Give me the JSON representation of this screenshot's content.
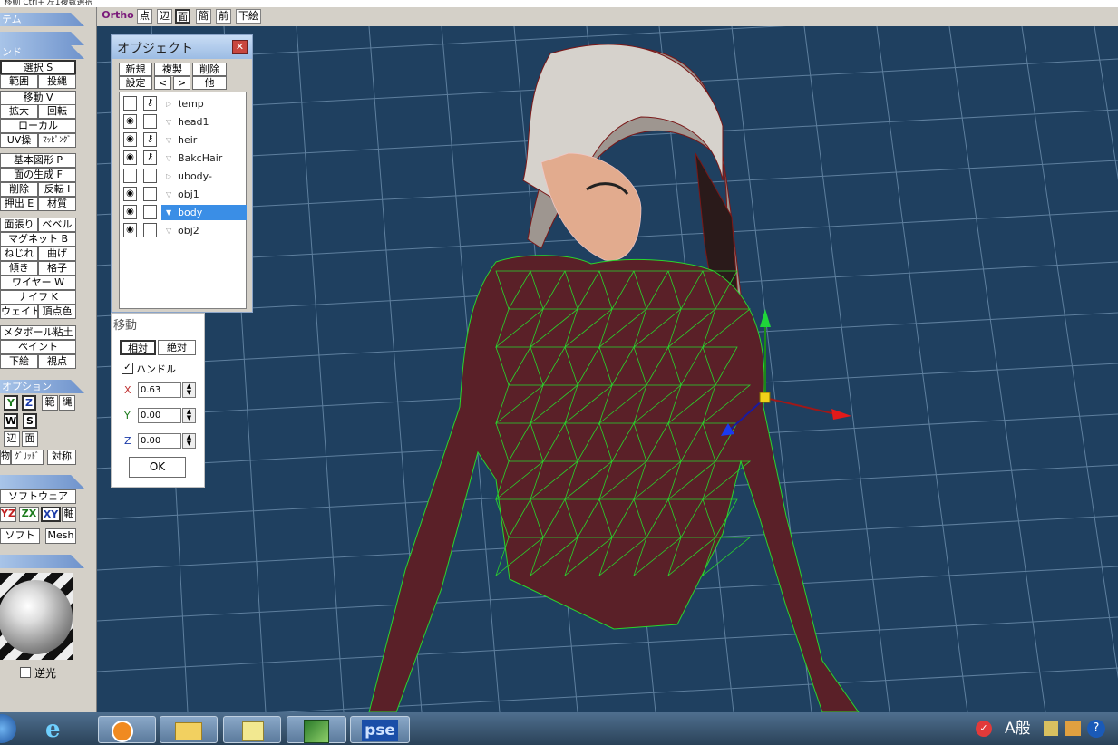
{
  "title_bar": {
    "text": "ﾞ移動  Ctrl+ 左1複数選択"
  },
  "left_panel": {
    "sections": {
      "system": "テム",
      "command_top": "",
      "command": "ンド",
      "option": "オプション",
      "soft": "",
      "material": ""
    },
    "buttons": {
      "select": "選択 S",
      "range": "範囲",
      "rope": "投縄",
      "move": "移動 V",
      "scale": "拡大",
      "rotate": "回転",
      "local": "ローカル",
      "uv": "UV操",
      "mapping": "ﾏｯﾋﾟﾝｸﾞ",
      "basic_shape": "基本図形 P",
      "face_gen": "面の生成 F",
      "delete": "削除",
      "flip": "反転 I",
      "extrude": "押出 E",
      "material": "材質",
      "face_stretch": "面張り",
      "bevel": "ベベル",
      "magnet": "マグネット B",
      "twist": "ねじれ",
      "bend": "曲げ",
      "tilt": "傾き",
      "lattice": "格子",
      "wire": "ワイヤー W",
      "knife": "ナイフ K",
      "weight": "ウェイト",
      "vertex_color": "頂点色",
      "metaball": "メタボール粘土",
      "paint": "ペイント",
      "underlay": "下絵",
      "viewpoint": "視点",
      "opt_y": "Y",
      "opt_z": "Z",
      "opt_range": "範",
      "opt_rope": "縄",
      "opt_w": "W",
      "opt_s": "S",
      "opt_edge": "辺",
      "opt_face": "面",
      "opt_obj": "物",
      "opt_grid": "ｸﾞﾘｯﾄﾞ",
      "opt_sym": "対称",
      "software": "ソフトウェア",
      "axis_yz": "YZ",
      "axis_zx": "ZX",
      "axis_xy": "XY",
      "axis": "軸",
      "soft": "ソフト",
      "mesh": "Mesh",
      "backlight": "逆光"
    }
  },
  "view_toolbar": {
    "ortho": "Ortho",
    "point": "点",
    "edge": "辺",
    "face": "面",
    "simple": "簡",
    "front": "前",
    "underlay": "下絵"
  },
  "object_dialog": {
    "title": "オブジェクト",
    "close": "✕",
    "buttons": {
      "new": "新規",
      "duplicate": "複製",
      "delete": "削除",
      "settings": "設定",
      "prev": "<",
      "next": ">",
      "other": "他"
    },
    "objects": [
      {
        "name": "temp",
        "visible": false,
        "locked": true,
        "selected": false
      },
      {
        "name": "head1",
        "visible": true,
        "locked": false,
        "selected": false
      },
      {
        "name": "heir",
        "visible": true,
        "locked": true,
        "selected": false
      },
      {
        "name": "BakcHair",
        "visible": true,
        "locked": true,
        "selected": false
      },
      {
        "name": "ubody-",
        "visible": false,
        "locked": false,
        "selected": false
      },
      {
        "name": "obj1",
        "visible": true,
        "locked": false,
        "selected": false
      },
      {
        "name": "body",
        "visible": true,
        "locked": false,
        "selected": true
      },
      {
        "name": "obj2",
        "visible": true,
        "locked": false,
        "selected": false
      }
    ]
  },
  "move_dialog": {
    "title": "移動",
    "relative": "相対",
    "absolute": "絶対",
    "handle_label": "ハンドル",
    "handle_checked": true,
    "x_label": "X",
    "x_value": "0.63",
    "y_label": "Y",
    "y_value": "0.00",
    "z_label": "Z",
    "z_value": "0.00",
    "ok": "OK"
  },
  "taskbar": {
    "pse_label": "pse",
    "tray_text": "A般"
  },
  "colors": {
    "viewport_bg": "#1f4060",
    "grid_line": "#6a8aa8",
    "wire_green": "#29d62c",
    "body_fill": "#5a2028",
    "selection": "#3a8ee6"
  }
}
